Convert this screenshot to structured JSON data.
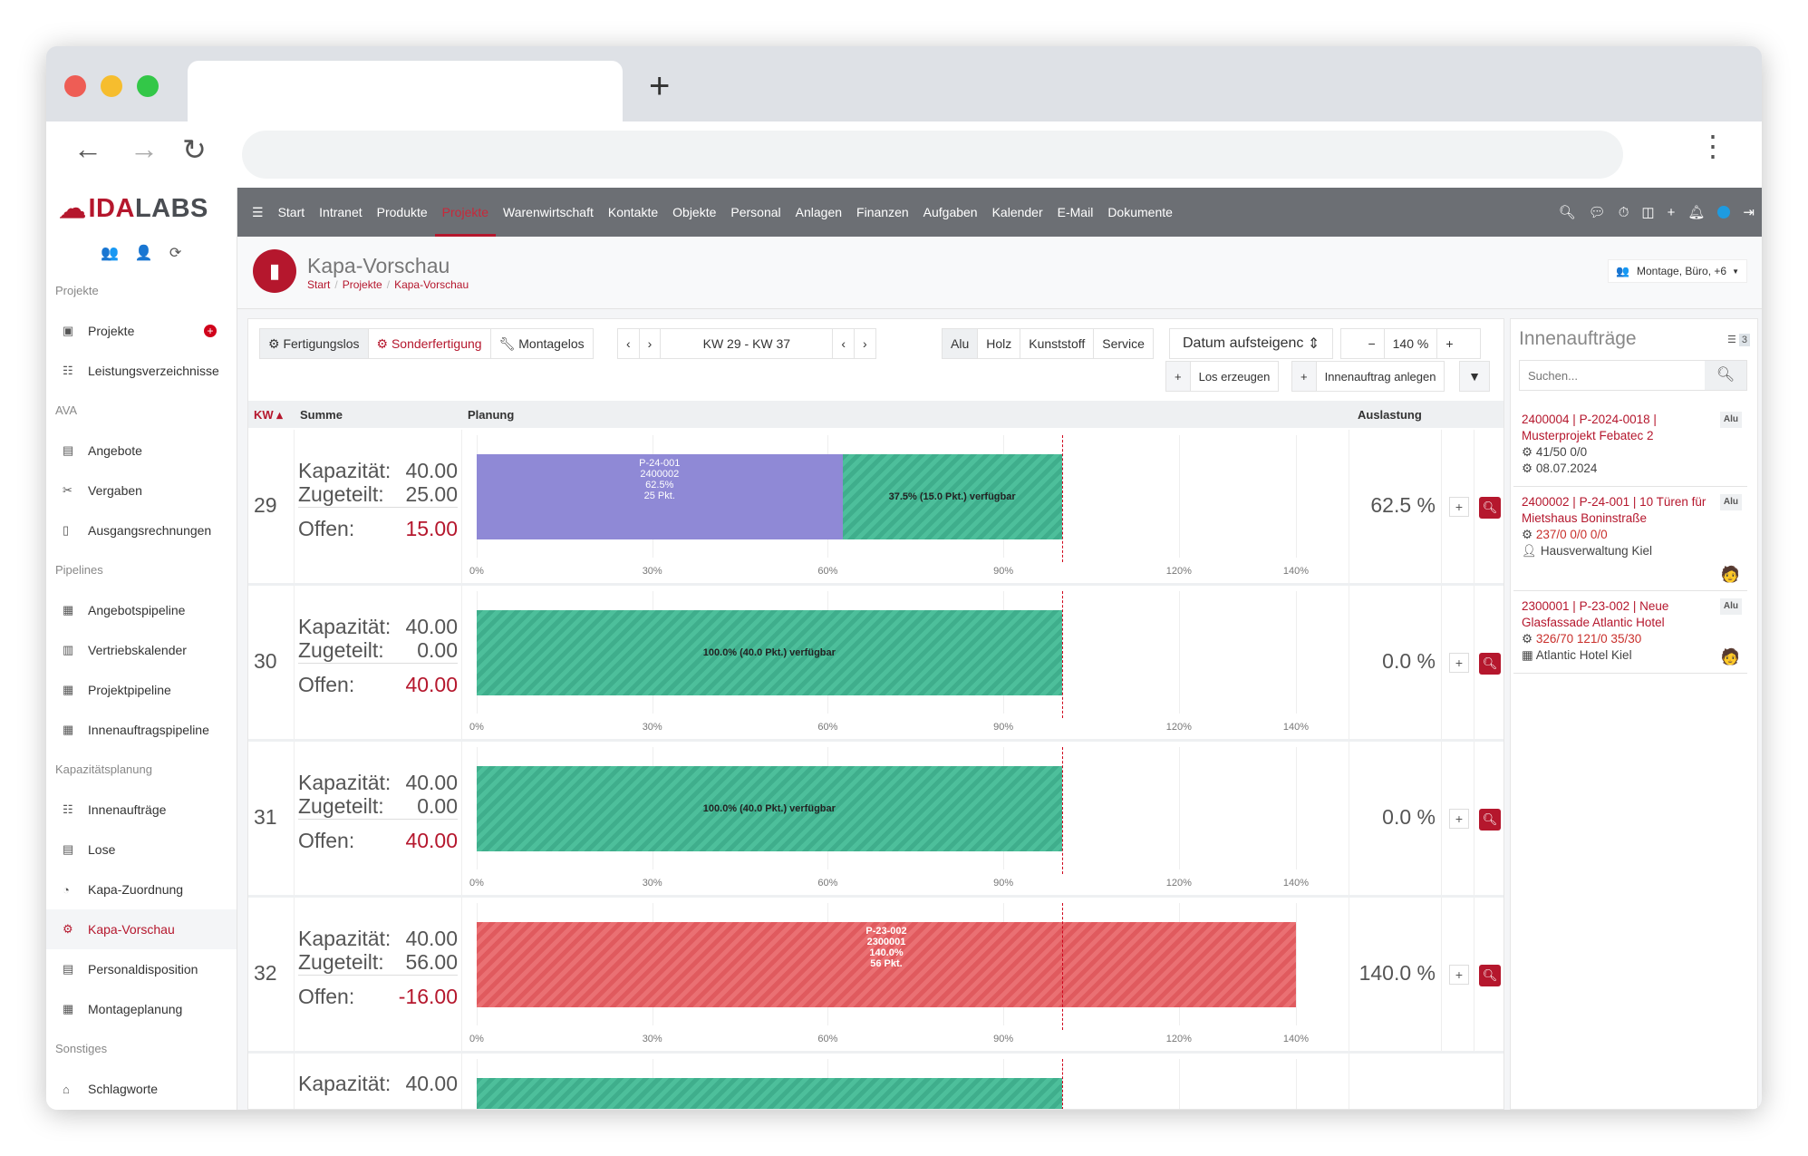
{
  "browser": {
    "new_tab": "+",
    "url": ""
  },
  "brand": {
    "ida": "IDA",
    "labs": "LABS"
  },
  "sidebar": {
    "sections": [
      {
        "title": "Projekte",
        "items": [
          {
            "label": "Projekte",
            "icon": "briefcase-icon",
            "badge": "+"
          },
          {
            "label": "Leistungsverzeichnisse",
            "icon": "list-icon"
          }
        ]
      },
      {
        "title": "AVA",
        "items": [
          {
            "label": "Angebote",
            "icon": "offer-icon"
          },
          {
            "label": "Vergaben",
            "icon": "award-icon"
          },
          {
            "label": "Ausgangsrechnungen",
            "icon": "invoice-icon"
          }
        ]
      },
      {
        "title": "Pipelines",
        "items": [
          {
            "label": "Angebotspipeline",
            "icon": "table-icon"
          },
          {
            "label": "Vertriebskalender",
            "icon": "calendar-icon"
          },
          {
            "label": "Projektpipeline",
            "icon": "table-icon"
          },
          {
            "label": "Innenauftragspipeline",
            "icon": "table-icon"
          }
        ]
      },
      {
        "title": "Kapazitätsplanung",
        "items": [
          {
            "label": "Innenaufträge",
            "icon": "list-icon"
          },
          {
            "label": "Lose",
            "icon": "document-icon"
          },
          {
            "label": "Kapa-Zuordnung",
            "icon": "clock-icon"
          },
          {
            "label": "Kapa-Vorschau",
            "icon": "conveyor-icon",
            "active": true
          },
          {
            "label": "Personaldisposition",
            "icon": "document-icon"
          },
          {
            "label": "Montageplanung",
            "icon": "table-icon"
          }
        ]
      },
      {
        "title": "Sonstiges",
        "items": [
          {
            "label": "Schlagworte",
            "icon": "tag-icon"
          }
        ]
      }
    ]
  },
  "topnav": {
    "items": [
      "Start",
      "Intranet",
      "Produkte",
      "Projekte",
      "Warenwirtschaft",
      "Kontakte",
      "Objekte",
      "Personal",
      "Anlagen",
      "Finanzen",
      "Aufgaben",
      "Kalender",
      "E-Mail",
      "Dokumente"
    ],
    "active": "Projekte"
  },
  "page": {
    "title": "Kapa-Vorschau",
    "breadcrumb": [
      "Start",
      "Projekte",
      "Kapa-Vorschau"
    ],
    "team_filter": "Montage, Büro, +6"
  },
  "toolbar": {
    "types": [
      "Fertigungslos",
      "Sonderfertigung",
      "Montagelos"
    ],
    "range": "KW 29 - KW 37",
    "materials": [
      "Alu",
      "Holz",
      "Kunststoff",
      "Service"
    ],
    "selected_material": "Alu",
    "sort": "Datum aufsteigenc",
    "zoom": "140 %",
    "create_lot": "Los erzeugen",
    "create_order": "Innenauftrag anlegen"
  },
  "table": {
    "headers": {
      "kw": "KW",
      "summe": "Summe",
      "planung": "Planung",
      "auslastung": "Auslastung"
    },
    "labels": {
      "kap": "Kapazität:",
      "zug": "Zugeteilt:",
      "off": "Offen:"
    },
    "axis_ticks": [
      "0%",
      "30%",
      "60%",
      "90%",
      "120%",
      "140%"
    ],
    "axis_max": 140,
    "limit": 100,
    "colors": {
      "allocated": "#8f89d6",
      "free": "#46b894",
      "over": "#e5656a",
      "accent": "#b5172d"
    },
    "weeks": [
      {
        "kw": "29",
        "kap": "40.00",
        "zug": "25.00",
        "off": "15.00",
        "ausl": "62.5 %",
        "segments": [
          {
            "type": "allocated",
            "pct": 62.5,
            "lines": [
              "P-24-001",
              "2400002",
              "62.5%",
              "25 Pkt."
            ]
          },
          {
            "type": "free",
            "pct": 37.5,
            "lines": [
              "37.5% (15.0 Pkt.) verfügbar"
            ]
          }
        ]
      },
      {
        "kw": "30",
        "kap": "40.00",
        "zug": "0.00",
        "off": "40.00",
        "ausl": "0.0 %",
        "segments": [
          {
            "type": "free",
            "pct": 100,
            "lines": [
              "100.0% (40.0 Pkt.) verfügbar"
            ]
          }
        ]
      },
      {
        "kw": "31",
        "kap": "40.00",
        "zug": "0.00",
        "off": "40.00",
        "ausl": "0.0 %",
        "segments": [
          {
            "type": "free",
            "pct": 100,
            "lines": [
              "100.0% (40.0 Pkt.) verfügbar"
            ]
          }
        ]
      },
      {
        "kw": "32",
        "kap": "40.00",
        "zug": "56.00",
        "off": "-16.00",
        "ausl": "140.0 %",
        "segments": [
          {
            "type": "over",
            "pct": 140,
            "lines": [
              "P-23-002",
              "2300001",
              "140.0%",
              "56 Pkt."
            ]
          }
        ]
      },
      {
        "kap": "40.00",
        "segments": [
          {
            "type": "free",
            "pct": 100,
            "lines": []
          }
        ]
      }
    ]
  },
  "panel": {
    "title": "Innenaufträge",
    "count": "3",
    "search_placeholder": "Suchen...",
    "orders": [
      {
        "title": "2400004 | P-2024-0018 | Musterprojekt Febatec 2",
        "tag": "Alu",
        "stats": "41/50   0/0",
        "date": "08.07.2024"
      },
      {
        "title": "2400002 | P-24-001 | 10 Türen für Mietshaus Boninstraße",
        "tag": "Alu",
        "stats": "237/0   0/0   0/0",
        "client": "Hausverwaltung Kiel"
      },
      {
        "title": "2300001 | P-23-002 | Neue Glasfassade Atlantic Hotel",
        "tag": "Alu",
        "stats": "326/70   121/0   35/30",
        "client": "Atlantic Hotel Kiel"
      }
    ]
  }
}
